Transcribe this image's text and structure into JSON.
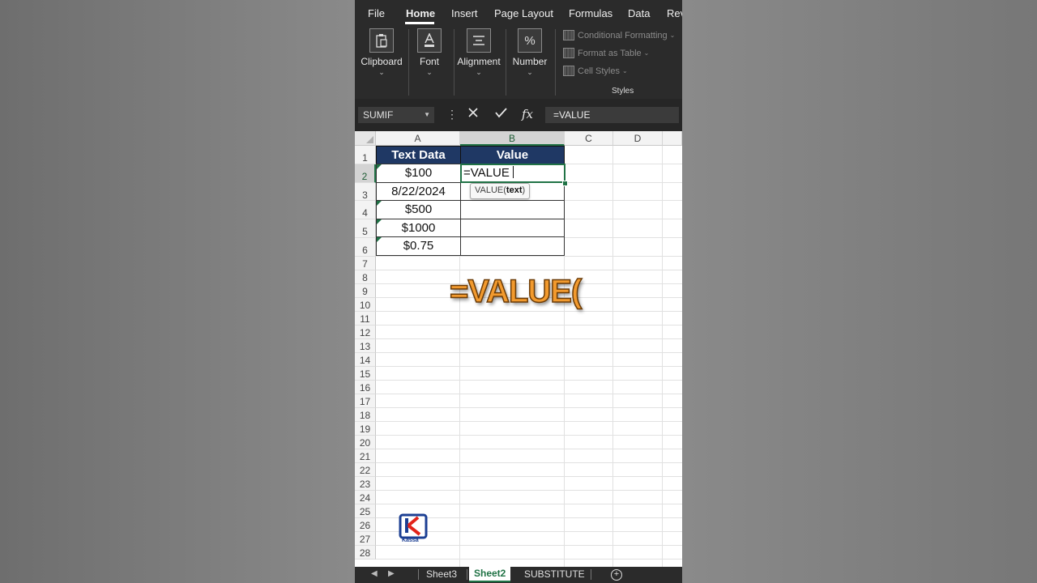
{
  "ribbon": {
    "tabs": [
      "File",
      "Home",
      "Insert",
      "Page Layout",
      "Formulas",
      "Data",
      "Rev"
    ],
    "active_tab": "Home",
    "groups": {
      "clipboard": "Clipboard",
      "font": "Font",
      "alignment": "Alignment",
      "number": "Number"
    },
    "styles": {
      "conditional_formatting": "Conditional Formatting",
      "format_as_table": "Format as Table",
      "cell_styles": "Cell Styles",
      "group_label": "Styles"
    }
  },
  "formula_bar": {
    "name_box": "SUMIF",
    "fx": "fx",
    "content": "=VALUE"
  },
  "grid": {
    "columns": [
      "A",
      "B",
      "C",
      "D"
    ],
    "selected_column": "B",
    "rows": [
      "1",
      "2",
      "3",
      "4",
      "5",
      "6",
      "7",
      "8",
      "9",
      "10",
      "11",
      "12",
      "13",
      "14",
      "15",
      "16",
      "17",
      "18",
      "19",
      "20",
      "21",
      "22",
      "23",
      "24",
      "25",
      "26",
      "27",
      "28"
    ],
    "selected_row": "2"
  },
  "table": {
    "headers": [
      "Text Data",
      "Value"
    ],
    "cells": [
      {
        "a": "$100"
      },
      {
        "a": "8/22/2024"
      },
      {
        "a": "$500"
      },
      {
        "a": "$1000"
      },
      {
        "a": "$0.75"
      }
    ],
    "active_cell_text": "=VALUE"
  },
  "tooltip": {
    "fn": "VALUE(",
    "arg": "text",
    "close": ")"
  },
  "overlay_text": "=VALUE(",
  "logo": {
    "caption": "Kassa",
    "brand_color": "#1c3f93",
    "accent_color": "#e2231a"
  },
  "sheets": {
    "tabs": [
      "Sheet3",
      "Sheet2",
      "SUBSTITUTE"
    ],
    "active": "Sheet2"
  },
  "colors": {
    "excel_green": "#217346",
    "header_fill": "#1f3864",
    "overlay_fill": "#f29a2e"
  }
}
